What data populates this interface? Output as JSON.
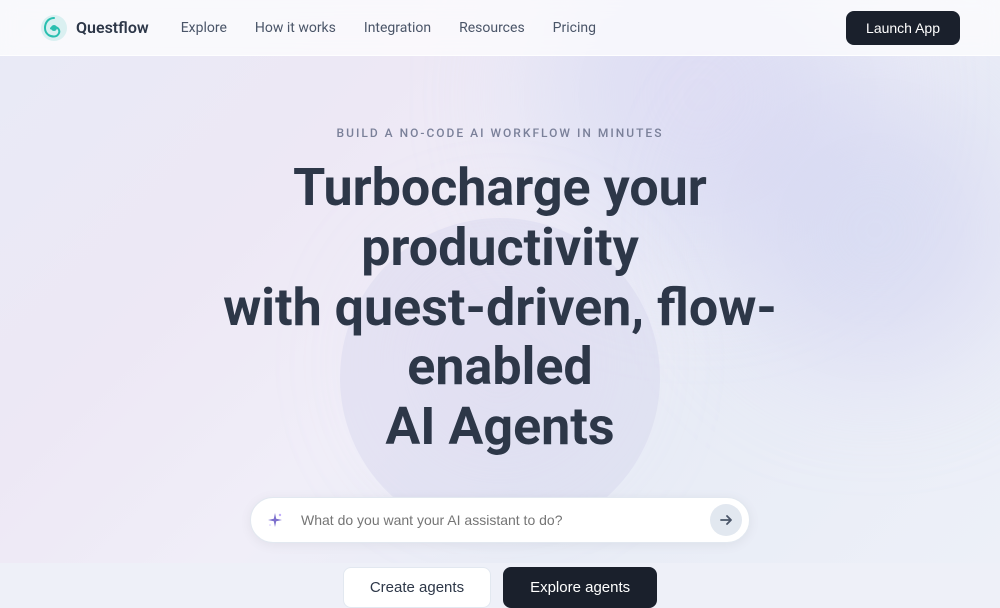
{
  "brand": {
    "name": "Questflow",
    "logo_alt": "Questflow logo"
  },
  "navbar": {
    "links": [
      {
        "label": "Explore",
        "key": "explore"
      },
      {
        "label": "How it works",
        "key": "how-it-works"
      },
      {
        "label": "Integration",
        "key": "integration"
      },
      {
        "label": "Resources",
        "key": "resources"
      },
      {
        "label": "Pricing",
        "key": "pricing"
      }
    ],
    "launch_button": "Launch App"
  },
  "hero": {
    "tagline": "BUILD A NO-CODE AI WORKFLOW IN MINUTES",
    "title_line1": "Turbocharge your productivity",
    "title_line2": "with quest-driven, flow-enabled",
    "title_line3": "AI Agents"
  },
  "search": {
    "placeholder": "What do you want your AI assistant to do?"
  },
  "cta": {
    "create_label": "Create agents",
    "explore_label": "Explore agents"
  },
  "colors": {
    "dark": "#1a202c",
    "accent": "#7c6fcd"
  }
}
